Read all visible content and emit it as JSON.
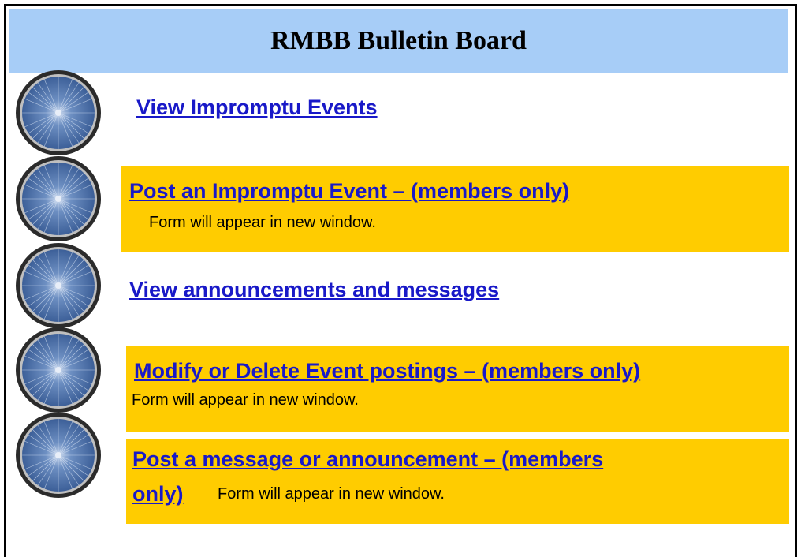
{
  "title": "RMBB Bulletin Board",
  "colors": {
    "banner": "#a7cdf7",
    "panel": "#ffcc00",
    "link": "#1919c8"
  },
  "icons": {
    "wheel": "bicycle-wheel-icon"
  },
  "items": [
    {
      "label": "View Impromptu Events"
    },
    {
      "label": "Post an Impromptu Event – (members only)",
      "note": "Form will appear in new window."
    },
    {
      "label": "View announcements and messages"
    },
    {
      "label": "Modify or Delete Event postings – (members only)",
      "note": "Form will appear in new window."
    },
    {
      "label_line1": "Post a message or announcement – (members",
      "label_line2": "only)",
      "note": "Form will appear in new window."
    }
  ]
}
